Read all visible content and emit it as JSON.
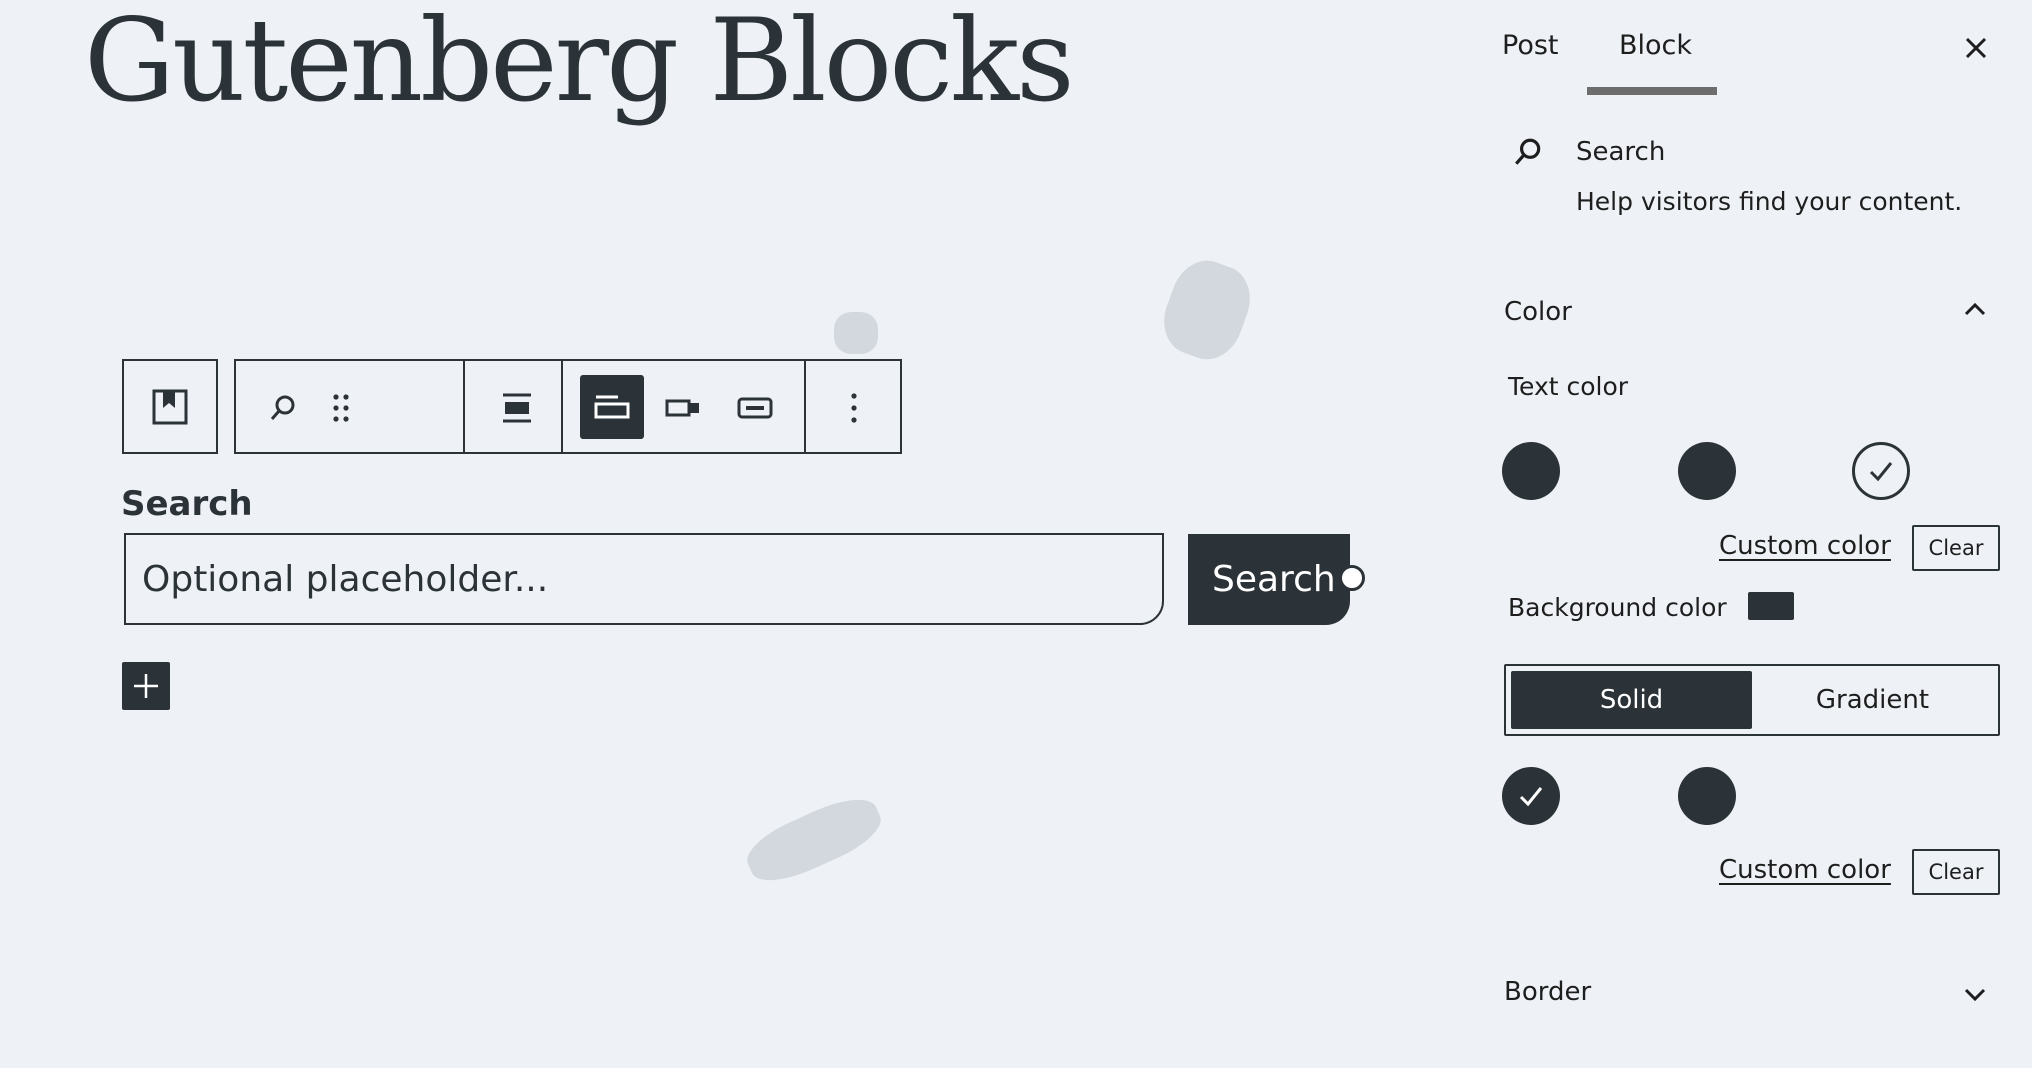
{
  "editor": {
    "post_title": "Gutenberg Blocks",
    "block_label": "Search",
    "search_input_placeholder": "Optional placeholder...",
    "search_button_label": "Search",
    "toolbar": {
      "icons": [
        "bookmark-icon",
        "search-icon",
        "drag-handle-icon",
        "justify-icon",
        "button-position-outside-icon",
        "button-position-inside-icon",
        "button-inside-input-icon",
        "more-options-icon"
      ]
    }
  },
  "sidebar": {
    "tabs": [
      {
        "label": "Post"
      },
      {
        "label": "Block",
        "active": true
      }
    ],
    "block_card": {
      "title": "Search",
      "description": "Help visitors find your content."
    },
    "color_panel": {
      "title": "Color",
      "text_color": {
        "label": "Text color",
        "custom_color_label": "Custom color",
        "clear_label": "Clear"
      },
      "background_color": {
        "label": "Background color",
        "tabs": [
          {
            "label": "Solid",
            "active": true
          },
          {
            "label": "Gradient",
            "active": false
          }
        ],
        "custom_color_label": "Custom color",
        "clear_label": "Clear"
      }
    },
    "border_panel": {
      "title": "Border"
    }
  },
  "colors": {
    "background": "#eef2f7",
    "ink": "#2c3338",
    "white": "#ffffff"
  }
}
